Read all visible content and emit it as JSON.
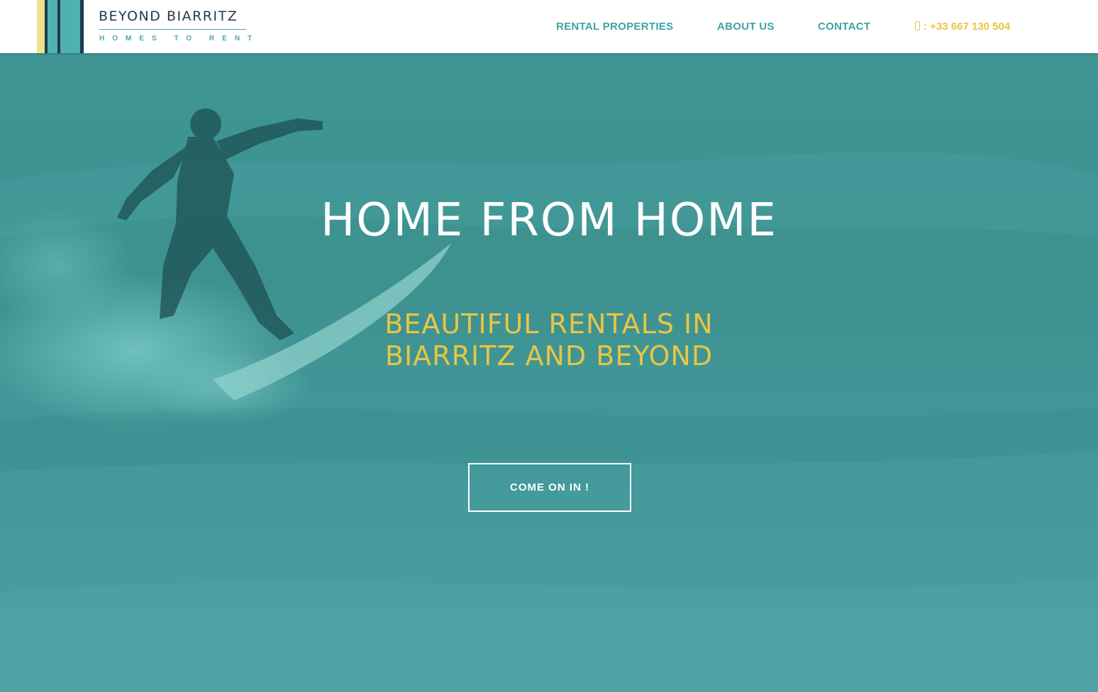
{
  "brand": {
    "name": "BEYOND BIARRITZ",
    "tagline": "HOMES TO RENT",
    "stripe_colors": [
      "#f1e08a",
      "#1e3b52",
      "#4fb1b1",
      "#2a8c92",
      "#1e3b52",
      "#ffffff"
    ]
  },
  "nav": {
    "items": [
      {
        "label": "RENTAL PROPERTIES"
      },
      {
        "label": "ABOUT US"
      },
      {
        "label": "CONTACT"
      }
    ],
    "phone_icon": "mobile-phone-icon",
    "phone": ": +33 667 130 504"
  },
  "hero": {
    "title": "HOME FROM HOME",
    "subtitle_line1": "BEAUTIFUL RENTALS IN",
    "subtitle_line2": "BIARRITZ AND BEYOND",
    "cta_label": "COME ON IN !",
    "background_subject": "surfer riding a wave"
  },
  "colors": {
    "teal": "#3da3a3",
    "yellow": "#e8c544",
    "navy": "#1f3a4d",
    "overlay": "#3f9695"
  }
}
